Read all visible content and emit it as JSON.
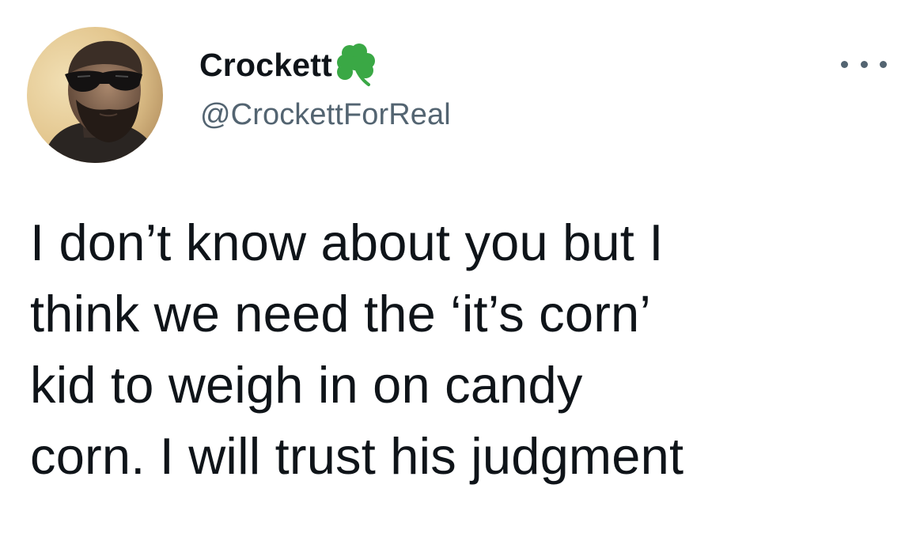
{
  "author": {
    "display_name": "Crockett",
    "handle": "@CrockettForReal",
    "badge_icon": "shamrock-icon",
    "badge_color": "#3aa845"
  },
  "tweet": {
    "lines": [
      "I don’t know about you but I",
      "think we need the ‘it’s corn’",
      "kid to weigh in on candy",
      "corn. I will trust his judgment"
    ]
  },
  "more_menu_icon": "more-horizontal-icon",
  "colors": {
    "text_primary": "#0f1419",
    "text_secondary": "#536471",
    "background": "#ffffff"
  }
}
